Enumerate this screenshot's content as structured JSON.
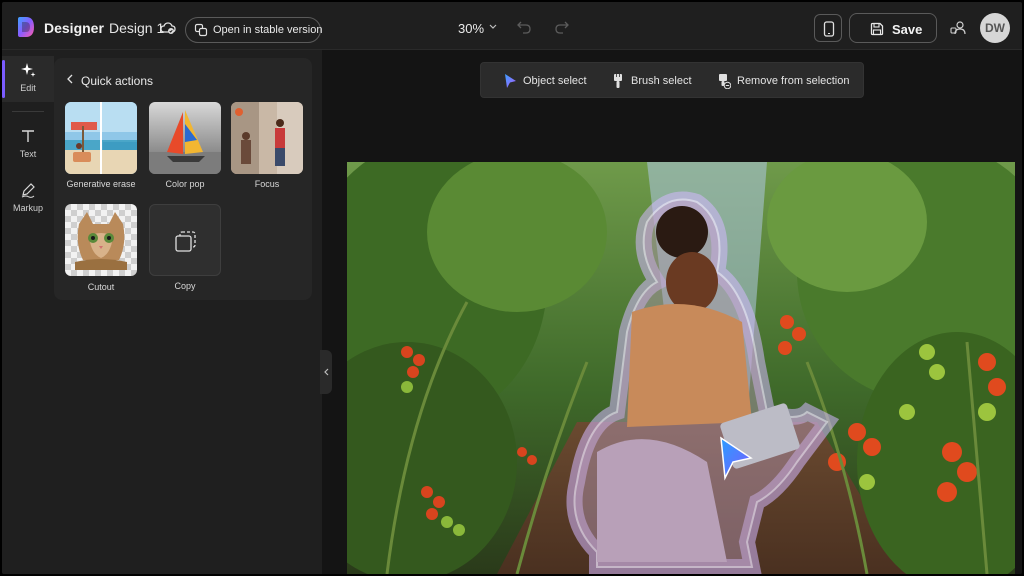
{
  "app": {
    "brand": "Designer",
    "design_name": "Design 1",
    "stable_version_label": "Open in stable version",
    "zoom": "30%",
    "save_label": "Save",
    "avatar_initials": "DW",
    "accent_color": "#7b5cff"
  },
  "rail": {
    "items": [
      {
        "label": "Edit",
        "icon": "sparkle-icon",
        "active": true
      },
      {
        "label": "Text",
        "icon": "text-icon",
        "active": false
      },
      {
        "label": "Markup",
        "icon": "pen-icon",
        "active": false
      }
    ]
  },
  "quick_actions": {
    "title": "Quick actions",
    "tiles": [
      {
        "label": "Generative erase",
        "icon": "generative-erase-thumbnail"
      },
      {
        "label": "Color pop",
        "icon": "color-pop-thumbnail"
      },
      {
        "label": "Focus",
        "icon": "focus-thumbnail"
      },
      {
        "label": "Cutout",
        "icon": "cutout-thumbnail"
      },
      {
        "label": "Copy",
        "icon": "copy-icon"
      }
    ]
  },
  "selection_toolbar": {
    "items": [
      {
        "label": "Object select",
        "icon": "cursor-icon"
      },
      {
        "label": "Brush select",
        "icon": "brush-icon"
      },
      {
        "label": "Remove from selection",
        "icon": "eraser-icon"
      }
    ]
  }
}
